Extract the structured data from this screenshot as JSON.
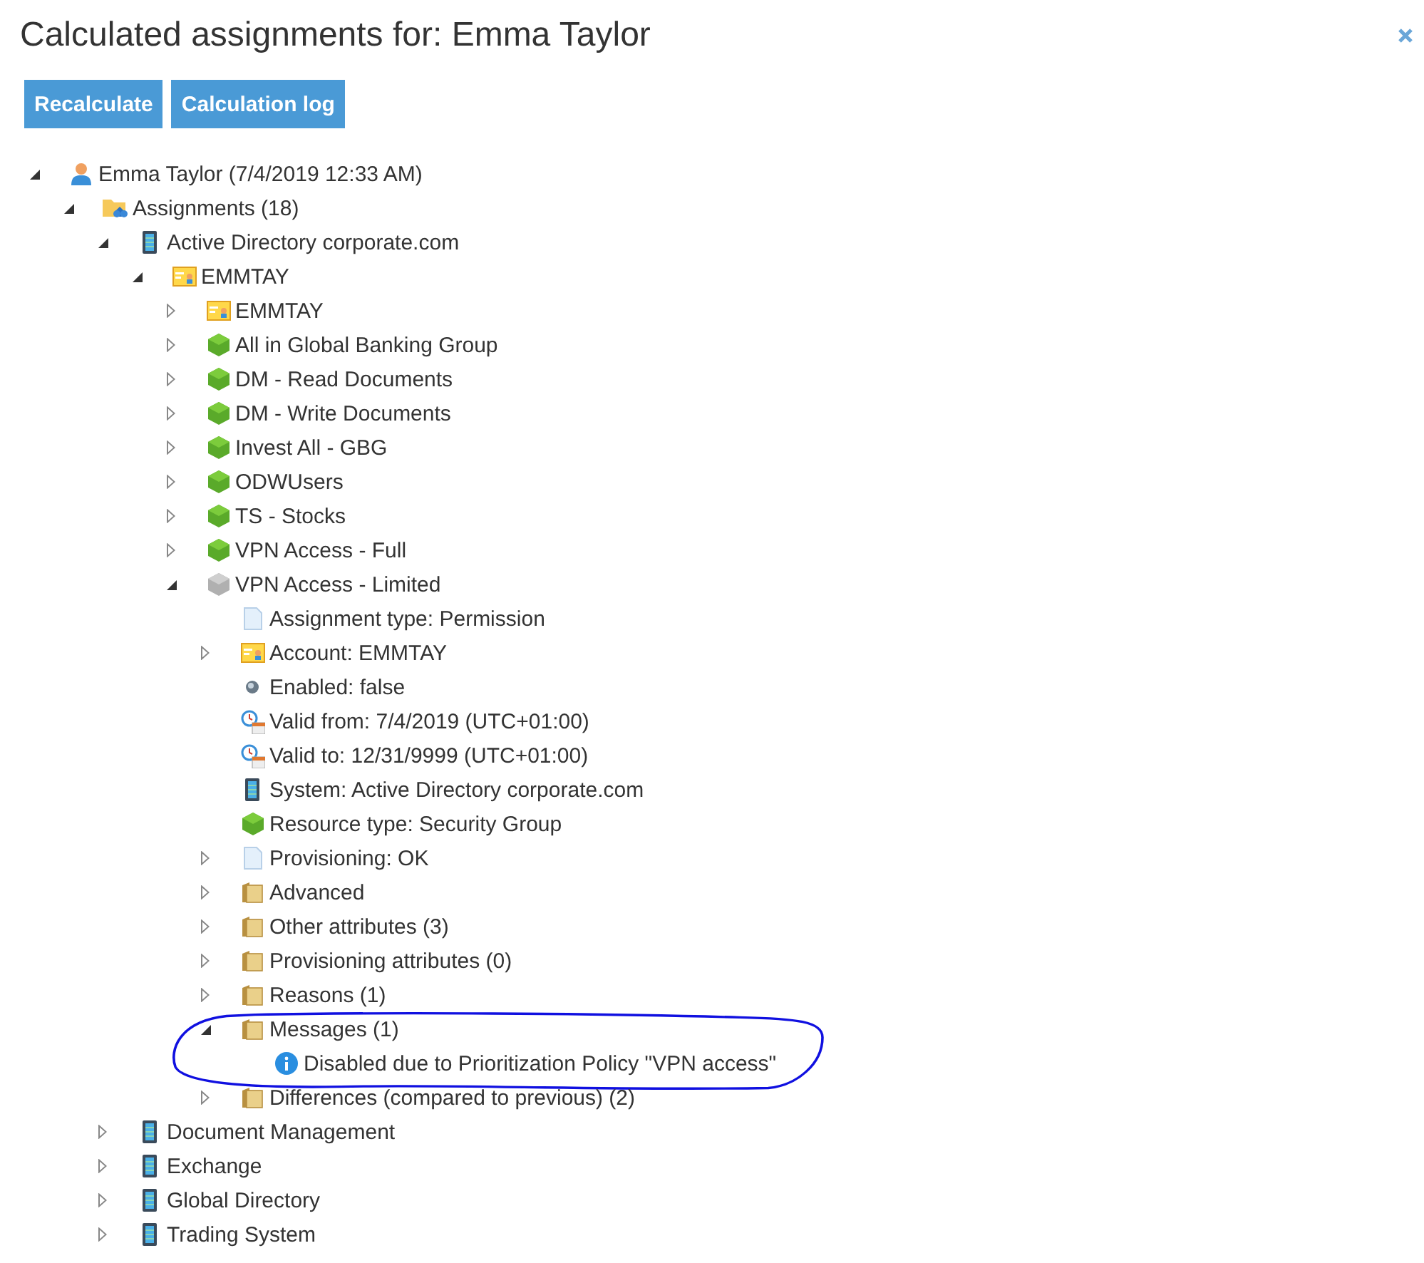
{
  "title": "Calculated assignments for: Emma Taylor",
  "buttons": [
    "Recalculate",
    "Calculation log"
  ],
  "tree": [
    {
      "label": "Emma Taylor (7/4/2019 12:33 AM)",
      "kind": "person",
      "expanded": true,
      "children": [
        {
          "label": "Assignments (18)",
          "kind": "assignments",
          "expanded": true,
          "children": [
            {
              "label": "Active Directory corporate.com",
              "kind": "system",
              "expanded": true,
              "children": [
                {
                  "label": "EMMTAY",
                  "kind": "account",
                  "expanded": true,
                  "children": [
                    {
                      "label": "EMMTAY",
                      "kind": "account",
                      "expanded": false
                    },
                    {
                      "label": "All in Global Banking Group",
                      "kind": "group",
                      "expanded": false
                    },
                    {
                      "label": "DM - Read Documents",
                      "kind": "group",
                      "expanded": false
                    },
                    {
                      "label": "DM - Write Documents",
                      "kind": "group",
                      "expanded": false
                    },
                    {
                      "label": "Invest All - GBG",
                      "kind": "group",
                      "expanded": false
                    },
                    {
                      "label": "ODWUsers",
                      "kind": "group",
                      "expanded": false
                    },
                    {
                      "label": "TS - Stocks",
                      "kind": "group",
                      "expanded": false
                    },
                    {
                      "label": "VPN Access - Full",
                      "kind": "group",
                      "expanded": false
                    },
                    {
                      "label": "VPN Access - Limited",
                      "kind": "group-disabled",
                      "expanded": true,
                      "children": [
                        {
                          "label": "Assignment type: Permission",
                          "kind": "document"
                        },
                        {
                          "label": "Account: EMMTAY",
                          "kind": "account",
                          "expanded": false
                        },
                        {
                          "label": "Enabled: false",
                          "kind": "dot"
                        },
                        {
                          "label": "Valid from: 7/4/2019 (UTC+01:00)",
                          "kind": "calendar"
                        },
                        {
                          "label": "Valid to: 12/31/9999 (UTC+01:00)",
                          "kind": "calendar"
                        },
                        {
                          "label": "System: Active Directory corporate.com",
                          "kind": "system"
                        },
                        {
                          "label": "Resource type: Security Group",
                          "kind": "group"
                        },
                        {
                          "label": "Provisioning: OK",
                          "kind": "document",
                          "expanded": false
                        },
                        {
                          "label": "Advanced",
                          "kind": "folder",
                          "expanded": false
                        },
                        {
                          "label": "Other attributes (3)",
                          "kind": "folder",
                          "expanded": false
                        },
                        {
                          "label": "Provisioning attributes (0)",
                          "kind": "folder",
                          "expanded": false
                        },
                        {
                          "label": "Reasons (1)",
                          "kind": "folder",
                          "expanded": false
                        },
                        {
                          "label": "Messages (1)",
                          "kind": "folder",
                          "expanded": true,
                          "highlighted": true,
                          "children": [
                            {
                              "label": "Disabled due to Prioritization Policy \"VPN access\"",
                              "kind": "info"
                            }
                          ]
                        },
                        {
                          "label": "Differences (compared to previous) (2)",
                          "kind": "folder",
                          "expanded": false
                        }
                      ]
                    }
                  ]
                }
              ]
            },
            {
              "label": "Document Management",
              "kind": "system",
              "expanded": false
            },
            {
              "label": "Exchange",
              "kind": "system",
              "expanded": false
            },
            {
              "label": "Global Directory",
              "kind": "system",
              "expanded": false
            },
            {
              "label": "Trading System",
              "kind": "system",
              "expanded": false
            }
          ]
        }
      ]
    }
  ]
}
